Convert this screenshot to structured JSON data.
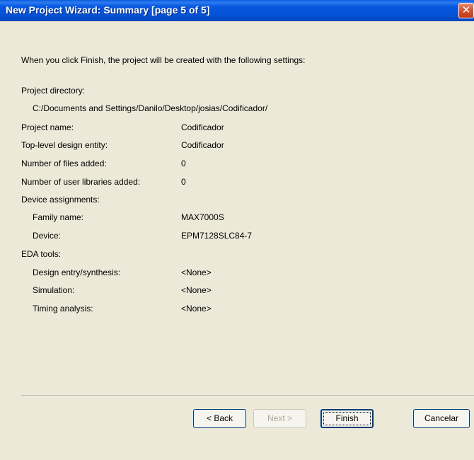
{
  "window": {
    "title": "New Project Wizard: Summary [page 5 of 5]",
    "close_glyph": "✕"
  },
  "intro": "When you click Finish, the project will be created with the following settings:",
  "project_directory": {
    "label": "Project directory:",
    "value": "C:/Documents and Settings/Danilo/Desktop/josias/Codificador/"
  },
  "project_name": {
    "label": "Project name:",
    "value": "Codificador"
  },
  "top_level_entity": {
    "label": "Top-level design entity:",
    "value": "Codificador"
  },
  "files_added": {
    "label": "Number of files added:",
    "value": "0"
  },
  "libraries_added": {
    "label": "Number of user libraries added:",
    "value": "0"
  },
  "device_assignments": {
    "label": "Device assignments:",
    "family": {
      "label": "Family name:",
      "value": "MAX7000S"
    },
    "device": {
      "label": "Device:",
      "value": "EPM7128SLC84-7"
    }
  },
  "eda_tools": {
    "label": "EDA tools:",
    "design_entry": {
      "label": "Design entry/synthesis:",
      "value": "<None>"
    },
    "simulation": {
      "label": "Simulation:",
      "value": "<None>"
    },
    "timing": {
      "label": "Timing analysis:",
      "value": "<None>"
    }
  },
  "buttons": {
    "back": "< Back",
    "next": "Next >",
    "finish": "Finish",
    "cancel": "Cancelar"
  },
  "colors": {
    "titlebar": "#0552D6",
    "dialog_bg": "#ECE9D8",
    "close_button": "#D14F2C"
  }
}
